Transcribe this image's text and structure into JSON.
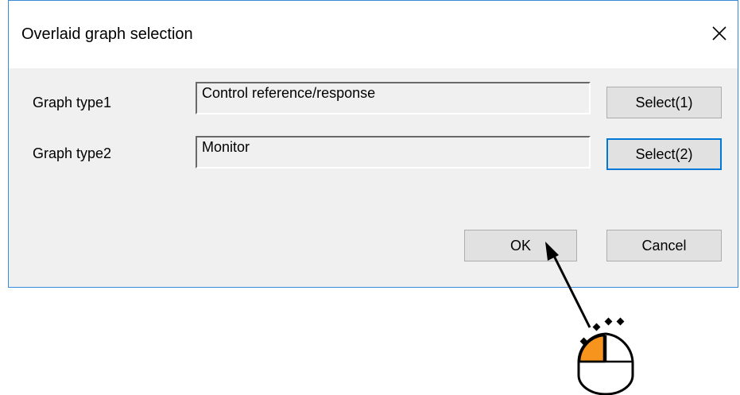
{
  "dialog": {
    "title": "Overlaid graph selection",
    "close_glyph": "✕",
    "rows": [
      {
        "label": "Graph type1",
        "value": "Control reference/response",
        "button": "Select(1)"
      },
      {
        "label": "Graph type2",
        "value": "Monitor",
        "button": "Select(2)"
      }
    ],
    "ok_label": "OK",
    "cancel_label": "Cancel"
  },
  "colors": {
    "accent": "#0078d7",
    "mouse_left_button": "#f7941d"
  },
  "icons": {
    "close": "close-icon",
    "pointer": "arrow-pointer-icon",
    "mouse": "mouse-left-click-icon"
  }
}
